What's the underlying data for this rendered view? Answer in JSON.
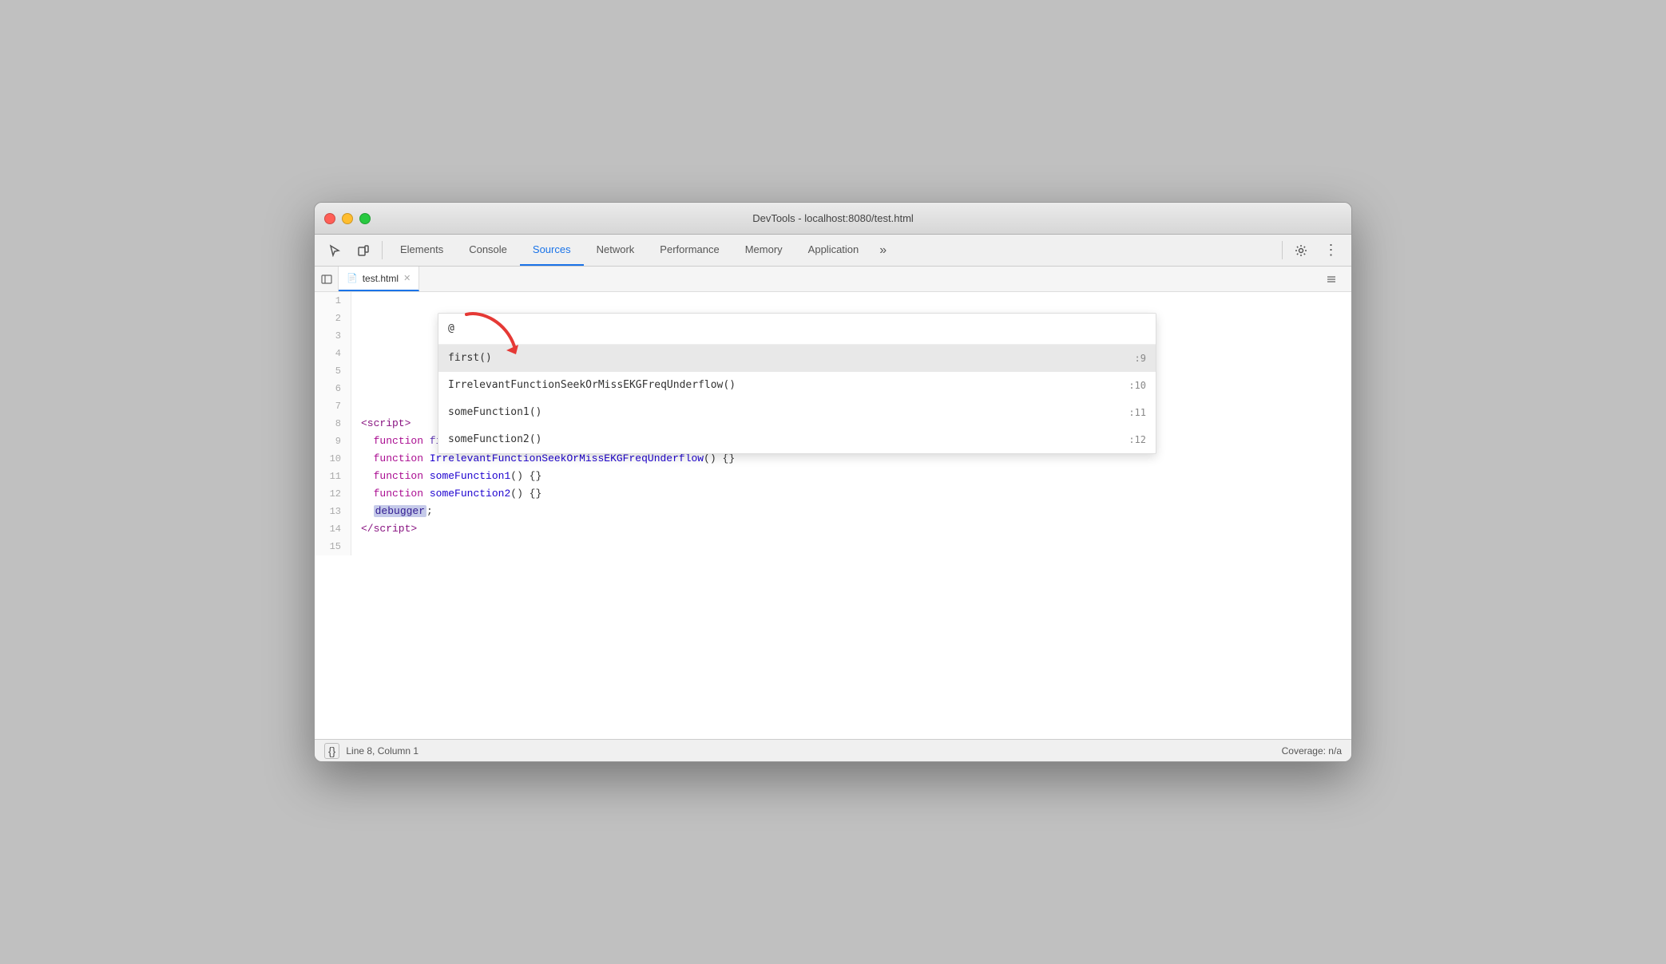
{
  "window": {
    "title": "DevTools - localhost:8080/test.html"
  },
  "toolbar": {
    "tabs": [
      {
        "id": "elements",
        "label": "Elements",
        "active": false
      },
      {
        "id": "console",
        "label": "Console",
        "active": false
      },
      {
        "id": "sources",
        "label": "Sources",
        "active": true
      },
      {
        "id": "network",
        "label": "Network",
        "active": false
      },
      {
        "id": "performance",
        "label": "Performance",
        "active": false
      },
      {
        "id": "memory",
        "label": "Memory",
        "active": false
      },
      {
        "id": "application",
        "label": "Application",
        "active": false
      }
    ],
    "more_label": "»"
  },
  "file_tab": {
    "name": "test.html"
  },
  "autocomplete": {
    "search_placeholder": "@",
    "items": [
      {
        "name": "first()",
        "line": ":9",
        "selected": true
      },
      {
        "name": "IrrelevantFunctionSeekOrMissEKGFreqUnderflow()",
        "line": ":10",
        "selected": false
      },
      {
        "name": "someFunction1()",
        "line": ":11",
        "selected": false
      },
      {
        "name": "someFunction2()",
        "line": ":12",
        "selected": false
      }
    ]
  },
  "code": {
    "lines": [
      {
        "num": "1",
        "content": ""
      },
      {
        "num": "2",
        "content": ""
      },
      {
        "num": "3",
        "content": ""
      },
      {
        "num": "4",
        "content": ""
      },
      {
        "num": "5",
        "content": ""
      },
      {
        "num": "6",
        "content": ""
      },
      {
        "num": "7",
        "content": ""
      },
      {
        "num": "8",
        "html": "<span class='kw-tag'>&lt;script&gt;</span>"
      },
      {
        "num": "9",
        "html": "  <span class='kw-function'>function</span> <span class='fn-name-first'>first</span><span class='punctuation'>() {}</span>"
      },
      {
        "num": "10",
        "html": "  <span class='kw-function'>function</span> <span class='fn-name'>IrrelevantFunctionSeekOrMissEKGFreqUnderflow</span><span class='punctuation'>() {}</span>"
      },
      {
        "num": "11",
        "html": "  <span class='kw-function'>function</span> <span class='fn-name'>someFunction1</span><span class='punctuation'>() {}</span>"
      },
      {
        "num": "12",
        "html": "  <span class='kw-function'>function</span> <span class='fn-name'>someFunction2</span><span class='punctuation'>() {}</span>"
      },
      {
        "num": "13",
        "html": "  <span class='kw-debugger'>debugger</span><span class='punctuation'>;</span>"
      },
      {
        "num": "14",
        "html": "<span class='kw-tag'>&lt;/script&gt;</span>"
      },
      {
        "num": "15",
        "content": ""
      }
    ]
  },
  "status_bar": {
    "format_label": "{}",
    "position": "Line 8, Column 1",
    "coverage": "Coverage: n/a"
  }
}
